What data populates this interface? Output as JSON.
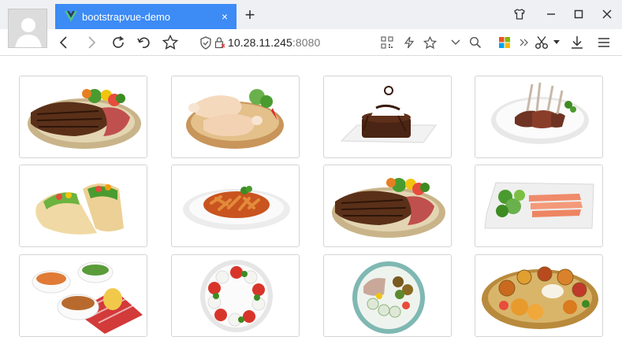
{
  "browser": {
    "tab_title": "bootstrapvue-demo",
    "tab_close": "×",
    "new_tab": "+",
    "address": {
      "host": "10.28.11.245",
      "port": ":8080"
    }
  },
  "gallery": {
    "items": [
      {
        "name": "steak-plate-icon"
      },
      {
        "name": "roast-chicken-icon"
      },
      {
        "name": "chocolate-cake-icon"
      },
      {
        "name": "lamb-chops-icon"
      },
      {
        "name": "tacos-icon"
      },
      {
        "name": "pasta-bowl-icon"
      },
      {
        "name": "steak-plate-icon"
      },
      {
        "name": "salmon-salad-icon"
      },
      {
        "name": "side-dishes-icon"
      },
      {
        "name": "caprese-plate-icon"
      },
      {
        "name": "salad-bowl-icon"
      },
      {
        "name": "indian-thali-icon"
      }
    ]
  },
  "colors": {
    "tab_active": "#3d8bf5",
    "tabstrip": "#eef0f3",
    "card_border": "#d4d4d4"
  }
}
